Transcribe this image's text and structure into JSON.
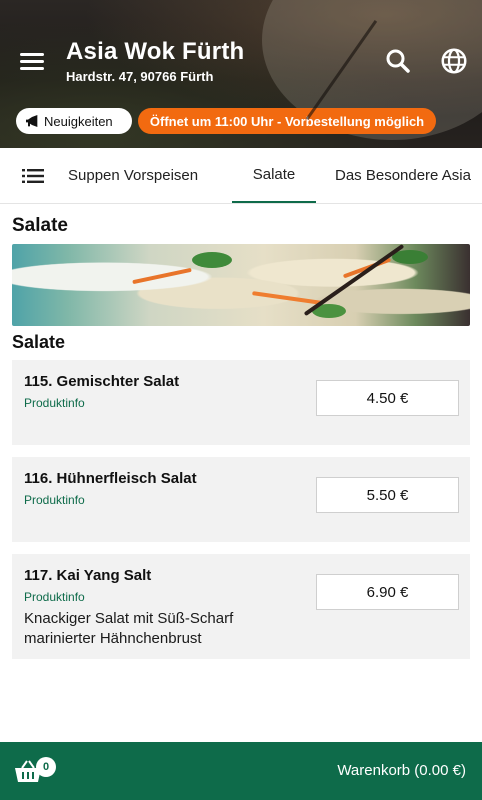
{
  "header": {
    "title": "Asia Wok Fürth",
    "address": "Hardstr. 47, 90766 Fürth",
    "menu_icon": "menu-icon",
    "search_icon": "search-icon",
    "language_icon": "globe-icon",
    "news_label": "Neuigkeiten",
    "news_icon": "megaphone-icon",
    "opening_notice": "Öffnet um 11:00 Uhr - Vorbestellung möglich",
    "opening_color": "#f26a10"
  },
  "tabs": {
    "list_icon": "list-icon",
    "items": [
      {
        "label": "Suppen Vorspeisen"
      },
      {
        "label": "Salate"
      },
      {
        "label": "Das Besondere Asia"
      }
    ],
    "active": "Salate",
    "accent": "#0e6b4a"
  },
  "main": {
    "category_title": "Salate",
    "subcategory_title": "Salate",
    "items": [
      {
        "name": "115. Gemischter Salat",
        "info": "Produktinfo",
        "price": "4.50 €",
        "description": ""
      },
      {
        "name": "116. Hühnerfleisch Salat",
        "info": "Produktinfo",
        "price": "5.50 €",
        "description": ""
      },
      {
        "name": "117.  Kai Yang Salt",
        "info": "Produktinfo",
        "price": "6.90 €",
        "description": "Knackiger Salat mit Süß-Scharf marinierter Hähnchenbrust"
      }
    ]
  },
  "cart": {
    "count": "0",
    "label": "Warenkorb (0.00 €)",
    "icon": "basket-icon",
    "color": "#0e6b4a"
  }
}
